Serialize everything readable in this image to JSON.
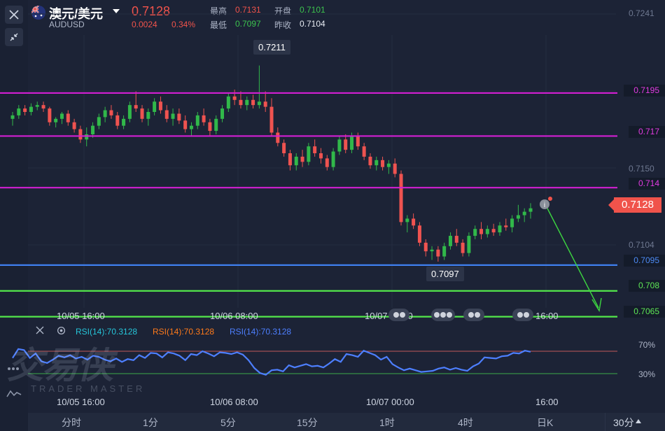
{
  "header": {
    "symbol_name": "澳元/美元",
    "symbol_code": "AUDUSD",
    "last_price": "0.7128",
    "change": "0.0024",
    "change_pct": "0.34%",
    "high_label": "最高",
    "high_value": "0.7131",
    "open_label": "开盘",
    "open_value": "0.7101",
    "low_label": "最低",
    "low_value": "0.7097",
    "prev_close_label": "昨收",
    "prev_close_value": "0.7104"
  },
  "price_axis": {
    "ticks": [
      "0.7241",
      "0.7150",
      "0.7104"
    ]
  },
  "levels": [
    {
      "label": "0.7195",
      "value": 0.7195,
      "color": "#d21fd2"
    },
    {
      "label": "0.717",
      "value": 0.717,
      "color": "#d21fd2"
    },
    {
      "label": "0.714",
      "value": 0.714,
      "color": "#d21fd2"
    },
    {
      "label": "0.7095",
      "value": 0.7095,
      "color": "#3f7ff0"
    },
    {
      "label": "0.708",
      "value": 0.708,
      "color": "#53e84b"
    },
    {
      "label": "0.7065",
      "value": 0.7065,
      "color": "#53e84b"
    }
  ],
  "current_price_tag": "0.7128",
  "callouts": {
    "high": "0.7211",
    "low": "0.7097"
  },
  "time_axis_main": [
    "10/05 16:00",
    "10/06 08:00",
    "10/07 00:00",
    "16:00"
  ],
  "time_axis_rsi": [
    "10/05 16:00",
    "10/06 08:00",
    "10/07 00:00",
    "16:00"
  ],
  "rsi": {
    "labels": [
      "RSI(14):70.3128",
      "RSI(14):70.3128",
      "RSI(14):70.3128"
    ],
    "colors": [
      "#26c6da",
      "#ff7a1a",
      "#4d7fff"
    ],
    "level_high": "70%",
    "level_low": "30%",
    "values": [
      58,
      74,
      72,
      58,
      66,
      52,
      49,
      55,
      62,
      59,
      63,
      57,
      60,
      55,
      62,
      60,
      55,
      52,
      57,
      51,
      56,
      54,
      63,
      58,
      67,
      66,
      59,
      68,
      66,
      62,
      54,
      65,
      63,
      70,
      66,
      61,
      68,
      67,
      65,
      68,
      64,
      54,
      40,
      31,
      28,
      36,
      37,
      34,
      45,
      41,
      44,
      47,
      43,
      44,
      41,
      48,
      56,
      51,
      65,
      63,
      60,
      71,
      67,
      63,
      55,
      60,
      47,
      41,
      36,
      39,
      36,
      33,
      34,
      35,
      39,
      41,
      37,
      40,
      37,
      35,
      43,
      48,
      59,
      58,
      57,
      61,
      62,
      67,
      66,
      71,
      69
    ]
  },
  "chart_data": {
    "type": "candlestick",
    "symbol": "AUDUSD",
    "ylim": [
      0.7062,
      0.7245
    ],
    "x_labels": [
      "10/05 16:00",
      "10/06 08:00",
      "10/07 00:00",
      "16:00"
    ],
    "candles": [
      [
        0.718,
        0.7184,
        0.7176,
        0.7182
      ],
      [
        0.7182,
        0.7188,
        0.718,
        0.7186
      ],
      [
        0.7186,
        0.7188,
        0.7182,
        0.7184
      ],
      [
        0.7184,
        0.7189,
        0.7182,
        0.7187
      ],
      [
        0.7187,
        0.719,
        0.7185,
        0.7188
      ],
      [
        0.7188,
        0.719,
        0.7184,
        0.7186
      ],
      [
        0.7186,
        0.7187,
        0.7176,
        0.7178
      ],
      [
        0.7178,
        0.7181,
        0.7175,
        0.718
      ],
      [
        0.718,
        0.7184,
        0.7177,
        0.7183
      ],
      [
        0.7183,
        0.7185,
        0.7176,
        0.7178
      ],
      [
        0.7178,
        0.718,
        0.7172,
        0.7174
      ],
      [
        0.7174,
        0.7176,
        0.7166,
        0.7168
      ],
      [
        0.7168,
        0.7175,
        0.7164,
        0.7171
      ],
      [
        0.7171,
        0.7178,
        0.7169,
        0.7176
      ],
      [
        0.7176,
        0.7183,
        0.7174,
        0.7181
      ],
      [
        0.7181,
        0.7187,
        0.7178,
        0.7185
      ],
      [
        0.7185,
        0.7188,
        0.718,
        0.7182
      ],
      [
        0.7182,
        0.7184,
        0.7174,
        0.7176
      ],
      [
        0.7176,
        0.7182,
        0.7174,
        0.718
      ],
      [
        0.718,
        0.719,
        0.7178,
        0.7188
      ],
      [
        0.7188,
        0.7196,
        0.7184,
        0.7186
      ],
      [
        0.7186,
        0.7188,
        0.7178,
        0.718
      ],
      [
        0.718,
        0.7186,
        0.7176,
        0.7184
      ],
      [
        0.7184,
        0.7192,
        0.7182,
        0.719
      ],
      [
        0.719,
        0.7193,
        0.7183,
        0.7185
      ],
      [
        0.7185,
        0.7188,
        0.7178,
        0.718
      ],
      [
        0.718,
        0.7186,
        0.7176,
        0.7183
      ],
      [
        0.7183,
        0.7186,
        0.7177,
        0.7179
      ],
      [
        0.7179,
        0.7182,
        0.7172,
        0.7174
      ],
      [
        0.7174,
        0.7178,
        0.717,
        0.7176
      ],
      [
        0.7176,
        0.7184,
        0.7174,
        0.7182
      ],
      [
        0.7182,
        0.7186,
        0.7176,
        0.7178
      ],
      [
        0.7178,
        0.718,
        0.717,
        0.7173
      ],
      [
        0.7173,
        0.7182,
        0.7171,
        0.718
      ],
      [
        0.718,
        0.7188,
        0.7178,
        0.7186
      ],
      [
        0.7186,
        0.7195,
        0.7184,
        0.7193
      ],
      [
        0.7193,
        0.7197,
        0.7188,
        0.7191
      ],
      [
        0.7191,
        0.7196,
        0.7186,
        0.7188
      ],
      [
        0.7188,
        0.7193,
        0.7185,
        0.7191
      ],
      [
        0.7191,
        0.7194,
        0.7186,
        0.7188
      ],
      [
        0.7188,
        0.7211,
        0.7186,
        0.719
      ],
      [
        0.719,
        0.7196,
        0.7184,
        0.7187
      ],
      [
        0.7187,
        0.7192,
        0.717,
        0.7172
      ],
      [
        0.7172,
        0.7175,
        0.7164,
        0.7166
      ],
      [
        0.7166,
        0.7168,
        0.7158,
        0.716
      ],
      [
        0.716,
        0.7162,
        0.715,
        0.7153
      ],
      [
        0.7153,
        0.716,
        0.715,
        0.7158
      ],
      [
        0.7158,
        0.7162,
        0.7152,
        0.7155
      ],
      [
        0.7155,
        0.7166,
        0.7153,
        0.7164
      ],
      [
        0.7164,
        0.7168,
        0.7158,
        0.716
      ],
      [
        0.716,
        0.7163,
        0.7154,
        0.7157
      ],
      [
        0.7157,
        0.7159,
        0.715,
        0.7152
      ],
      [
        0.7152,
        0.7163,
        0.715,
        0.7161
      ],
      [
        0.7161,
        0.717,
        0.7159,
        0.7168
      ],
      [
        0.7168,
        0.7171,
        0.716,
        0.7162
      ],
      [
        0.7162,
        0.7172,
        0.716,
        0.717
      ],
      [
        0.717,
        0.7172,
        0.7162,
        0.7164
      ],
      [
        0.7164,
        0.7166,
        0.7156,
        0.7158
      ],
      [
        0.7158,
        0.716,
        0.7151,
        0.7153
      ],
      [
        0.7153,
        0.7158,
        0.715,
        0.7156
      ],
      [
        0.7156,
        0.7158,
        0.715,
        0.7152
      ],
      [
        0.7152,
        0.7156,
        0.7148,
        0.7154
      ],
      [
        0.7154,
        0.7157,
        0.7146,
        0.7148
      ],
      [
        0.7148,
        0.715,
        0.7118,
        0.712
      ],
      [
        0.712,
        0.7124,
        0.7114,
        0.7122
      ],
      [
        0.7122,
        0.7125,
        0.7116,
        0.7118
      ],
      [
        0.7118,
        0.712,
        0.7106,
        0.7108
      ],
      [
        0.7108,
        0.711,
        0.71,
        0.7103
      ],
      [
        0.7103,
        0.7106,
        0.7098,
        0.7104
      ],
      [
        0.7104,
        0.7106,
        0.7097,
        0.71
      ],
      [
        0.71,
        0.7108,
        0.7098,
        0.7106
      ],
      [
        0.7106,
        0.7114,
        0.7104,
        0.7112
      ],
      [
        0.7112,
        0.7116,
        0.7106,
        0.7108
      ],
      [
        0.7108,
        0.711,
        0.71,
        0.7102
      ],
      [
        0.7102,
        0.7114,
        0.71,
        0.7112
      ],
      [
        0.7112,
        0.7118,
        0.711,
        0.7116
      ],
      [
        0.7116,
        0.712,
        0.711,
        0.7113
      ],
      [
        0.7113,
        0.7118,
        0.7111,
        0.7116
      ],
      [
        0.7116,
        0.7119,
        0.7112,
        0.7114
      ],
      [
        0.7114,
        0.712,
        0.7112,
        0.7118
      ],
      [
        0.7118,
        0.7122,
        0.7115,
        0.7117
      ],
      [
        0.7117,
        0.7124,
        0.7114,
        0.7122
      ],
      [
        0.7122,
        0.713,
        0.712,
        0.7124
      ],
      [
        0.7124,
        0.7128,
        0.712,
        0.7126
      ],
      [
        0.7126,
        0.7131,
        0.7122,
        0.7128
      ]
    ]
  },
  "timeframe_tabs": [
    "分时",
    "1分",
    "5分",
    "15分",
    "1时",
    "4时",
    "日K",
    "30分"
  ],
  "watermark": {
    "cn": "交易侠",
    "en": "TRADER MASTER"
  }
}
